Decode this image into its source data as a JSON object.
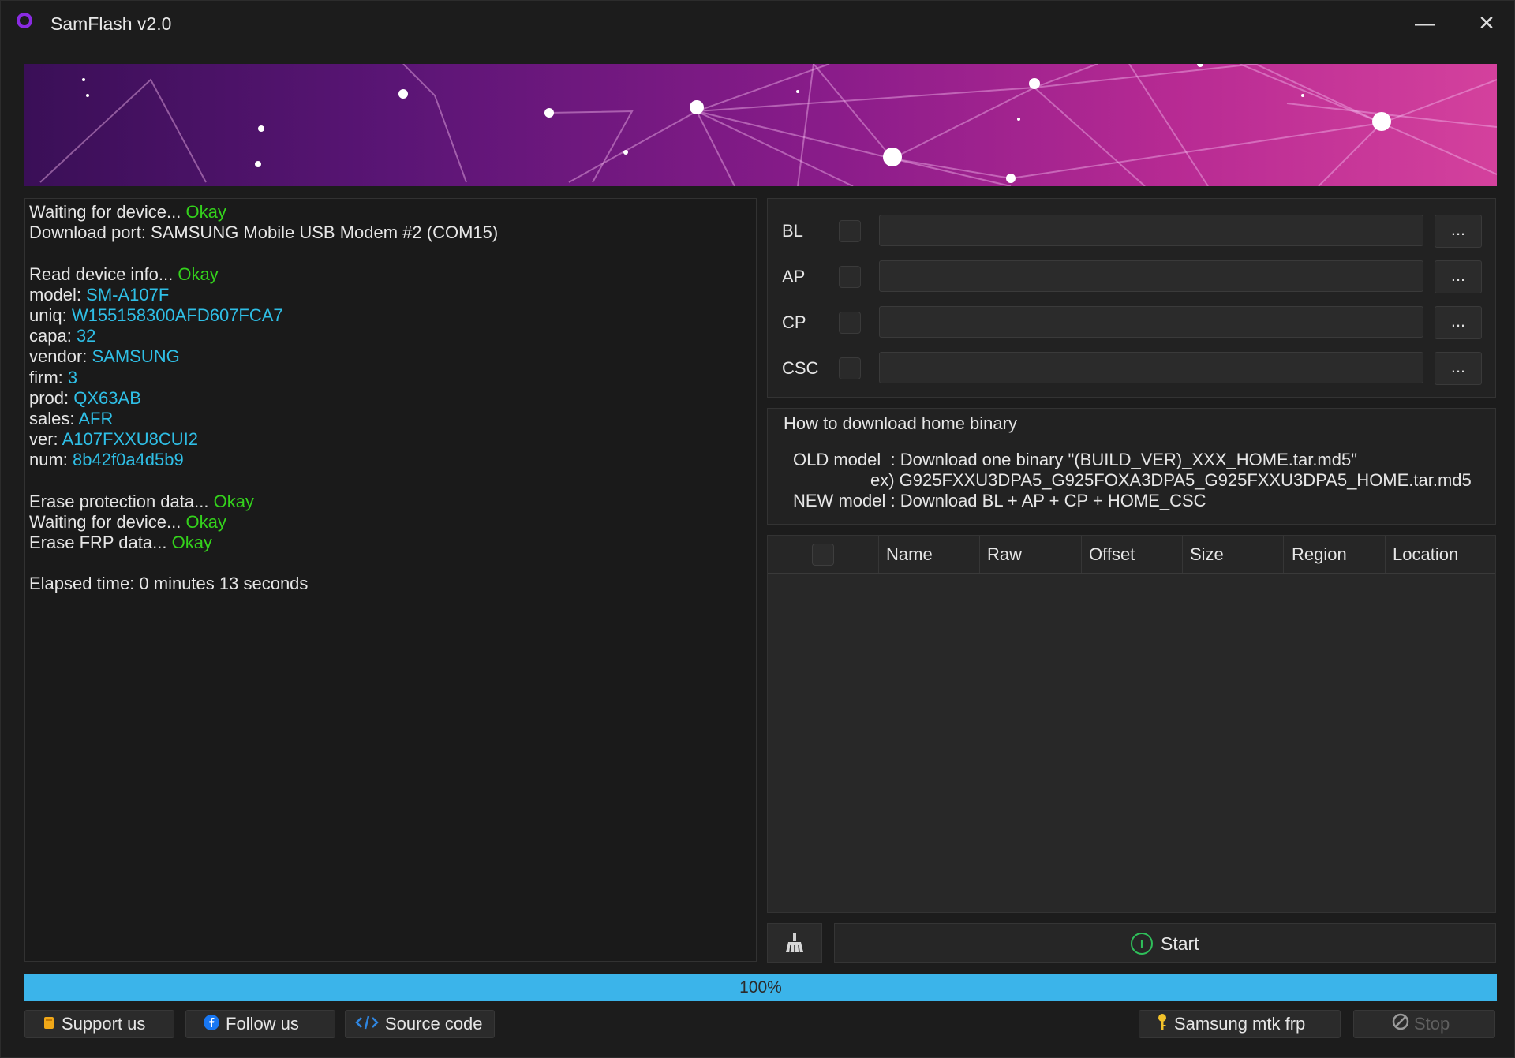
{
  "window": {
    "title": "SamFlash v2.0",
    "minimize_glyph": "—",
    "close_glyph": "✕"
  },
  "colors": {
    "accent": "#3bb4ea",
    "ok": "#34d21c",
    "value": "#2fbfe6",
    "banner_start": "#3a0f57",
    "banner_end": "#d4419d"
  },
  "log": {
    "lines": [
      {
        "text": "Waiting for device... ",
        "status": "Okay"
      },
      {
        "text": "Download port: SAMSUNG Mobile USB Modem #2 (COM15)"
      },
      {
        "text": ""
      },
      {
        "text": "Read device info... ",
        "status": "Okay"
      },
      {
        "label": "model: ",
        "value": "SM-A107F"
      },
      {
        "label": "uniq: ",
        "value": "W155158300AFD607FCA7"
      },
      {
        "label": "capa: ",
        "value": "32"
      },
      {
        "label": "vendor: ",
        "value": "SAMSUNG"
      },
      {
        "label": "firm: ",
        "value": "3"
      },
      {
        "label": "prod: ",
        "value": "QX63AB"
      },
      {
        "label": "sales: ",
        "value": "AFR"
      },
      {
        "label": "ver: ",
        "value": "A107FXXU8CUI2"
      },
      {
        "label": "num: ",
        "value": "8b42f0a4d5b9"
      },
      {
        "text": ""
      },
      {
        "text": "Erase protection data... ",
        "status": "Okay"
      },
      {
        "text": "Waiting for device... ",
        "status": "Okay"
      },
      {
        "text": "Erase FRP data... ",
        "status": "Okay"
      },
      {
        "text": ""
      },
      {
        "text": "Elapsed time: 0 minutes 13 seconds"
      }
    ]
  },
  "firmware": {
    "rows": [
      {
        "label": "BL",
        "path": "",
        "browse": "..."
      },
      {
        "label": "AP",
        "path": "",
        "browse": "..."
      },
      {
        "label": "CP",
        "path": "",
        "browse": "..."
      },
      {
        "label": "CSC",
        "path": "",
        "browse": "..."
      }
    ]
  },
  "help": {
    "title": "How to download home binary",
    "old_model": "OLD model  : Download one binary \"(BUILD_VER)_XXX_HOME.tar.md5\"",
    "example": "ex) G925FXXU3DPA5_G925FOXA3DPA5_G925FXXU3DPA5_HOME.tar.md5",
    "new_model": "NEW model : Download BL + AP + CP + HOME_CSC"
  },
  "table": {
    "columns": [
      "Name",
      "Raw",
      "Offset",
      "Size",
      "Region",
      "Location"
    ]
  },
  "start": {
    "label": "Start"
  },
  "progress": {
    "percent": 100,
    "label": "100%"
  },
  "footer": {
    "support": "Support us",
    "follow": "Follow us",
    "source": "Source code",
    "mtk": "Samsung mtk frp",
    "stop": "Stop"
  }
}
